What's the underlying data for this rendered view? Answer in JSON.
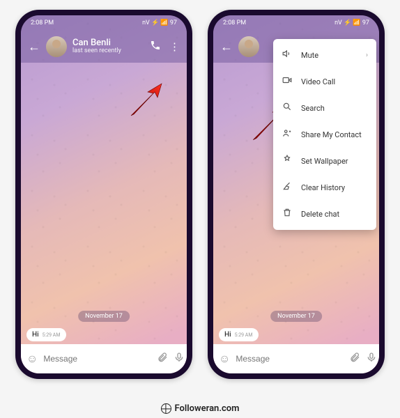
{
  "statusbar": {
    "time": "2:08 PM",
    "indicators": "nV  ⚡ 📶 97"
  },
  "header": {
    "contact_name": "Can Benli",
    "status_text": "last seen recently"
  },
  "chat": {
    "date_label": "November 17",
    "incoming_message": "Hi",
    "incoming_time": "5:29 AM",
    "input_placeholder": "Message"
  },
  "menu": {
    "items": [
      {
        "icon": "🔇",
        "label": "Mute",
        "has_submenu": true
      },
      {
        "icon": "📹",
        "label": "Video Call",
        "has_submenu": false
      },
      {
        "icon": "🔍",
        "label": "Search",
        "has_submenu": false
      },
      {
        "icon": "👤",
        "label": "Share My Contact",
        "has_submenu": false
      },
      {
        "icon": "🖼",
        "label": "Set Wallpaper",
        "has_submenu": false
      },
      {
        "icon": "🧹",
        "label": "Clear History",
        "has_submenu": false
      },
      {
        "icon": "🗑",
        "label": "Delete chat",
        "has_submenu": false
      }
    ]
  },
  "footer": {
    "site": "Followeran.com"
  }
}
